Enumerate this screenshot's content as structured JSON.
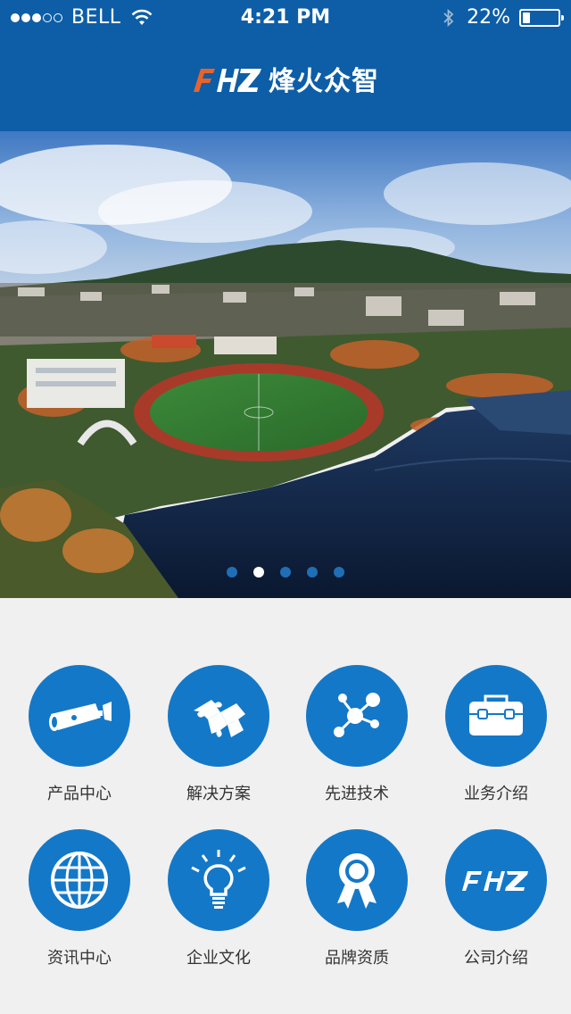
{
  "status_bar": {
    "carrier": "BELL",
    "time": "4:21 PM",
    "battery": "22%",
    "battery_level": 0.22,
    "signal_bars_filled": 3,
    "signal_bars_total": 5
  },
  "header": {
    "logo_mark": "FHZ",
    "logo_text": "烽火众智",
    "background": "#0d5ea7"
  },
  "carousel": {
    "total_slides": 5,
    "active_index": 1
  },
  "grid": {
    "items": [
      {
        "label": "产品中心",
        "icon": "camera-icon"
      },
      {
        "label": "解决方案",
        "icon": "puzzle-icon"
      },
      {
        "label": "先进技术",
        "icon": "molecule-icon"
      },
      {
        "label": "业务介绍",
        "icon": "briefcase-icon"
      },
      {
        "label": "资讯中心",
        "icon": "globe-icon"
      },
      {
        "label": "企业文化",
        "icon": "lightbulb-icon"
      },
      {
        "label": "品牌资质",
        "icon": "award-icon"
      },
      {
        "label": "公司介绍",
        "icon": "fhz-logo-icon"
      }
    ],
    "circle_color": "#1478c8"
  }
}
